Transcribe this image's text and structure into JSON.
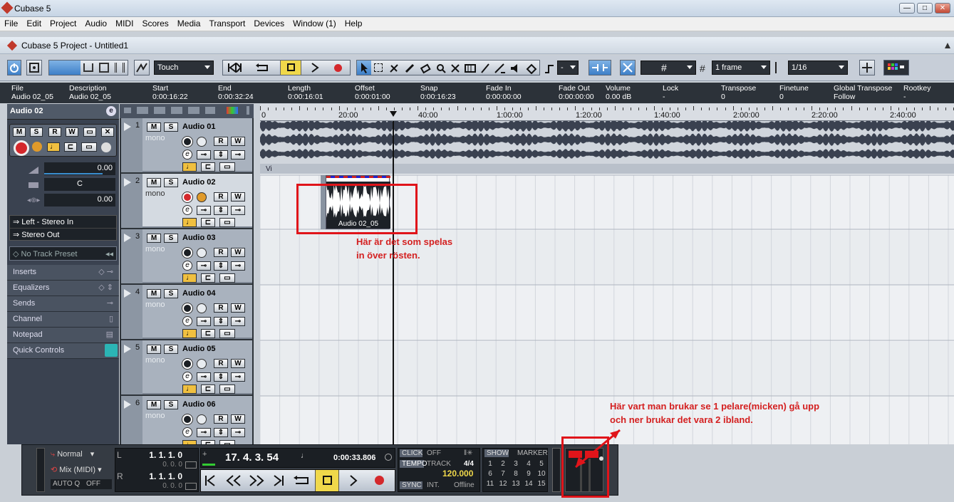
{
  "window": {
    "title": "Cubase 5",
    "buttons": [
      "—",
      "□",
      "✕"
    ]
  },
  "menu": [
    "File",
    "Edit",
    "Project",
    "Audio",
    "MIDI",
    "Scores",
    "Media",
    "Transport",
    "Devices",
    "Window (1)",
    "Help"
  ],
  "project_title": "Cubase 5 Project - Untitled1",
  "toolbar": {
    "automation_mode": "Touch",
    "nudge": "-",
    "grid_type_value": "",
    "quantize_label": "1 frame",
    "quantize_value": "1/16"
  },
  "infoline": {
    "columns": [
      {
        "label": "File",
        "value": "Audio 02_05"
      },
      {
        "label": "Description",
        "value": "Audio 02_05"
      },
      {
        "label": "Start",
        "value": "0:00:16:22"
      },
      {
        "label": "End",
        "value": "0:00:32:24"
      },
      {
        "label": "Length",
        "value": "0:00:16:01"
      },
      {
        "label": "Offset",
        "value": "0:00:01:00"
      },
      {
        "label": "Snap",
        "value": "0:00:16:23"
      },
      {
        "label": "Fade In",
        "value": "0:00:00:00"
      },
      {
        "label": "Fade Out",
        "value": "0:00:00:00"
      },
      {
        "label": "Volume",
        "value": "0.00 dB"
      },
      {
        "label": "Lock",
        "value": "-"
      },
      {
        "label": "Transpose",
        "value": "0"
      },
      {
        "label": "Finetune",
        "value": "0"
      },
      {
        "label": "Global Transpose",
        "value": "Follow"
      },
      {
        "label": "Rootkey",
        "value": "-"
      }
    ]
  },
  "inspector": {
    "track_name": "Audio 02",
    "volume": "0.00",
    "pan": "C",
    "delay": "0.00",
    "input_routing": "Left - Stereo In",
    "output_routing": "Stereo Out",
    "preset": "No Track Preset",
    "sections": [
      "Inserts",
      "Equalizers",
      "Sends",
      "Channel",
      "Notepad",
      "Quick Controls"
    ]
  },
  "tracks": [
    {
      "num": "1",
      "name": "Audio 01",
      "type": "mono",
      "m": "M",
      "s": "S",
      "r": "R",
      "w": "W",
      "recording": false
    },
    {
      "num": "2",
      "name": "Audio 02",
      "type": "mono",
      "m": "M",
      "s": "S",
      "r": "R",
      "w": "W",
      "recording": true
    },
    {
      "num": "3",
      "name": "Audio 03",
      "type": "mono",
      "m": "M",
      "s": "S",
      "r": "R",
      "w": "W",
      "recording": false
    },
    {
      "num": "4",
      "name": "Audio 04",
      "type": "mono",
      "m": "M",
      "s": "S",
      "r": "R",
      "w": "W",
      "recording": false
    },
    {
      "num": "5",
      "name": "Audio 05",
      "type": "mono",
      "m": "M",
      "s": "S",
      "r": "R",
      "w": "W",
      "recording": false
    },
    {
      "num": "6",
      "name": "Audio 06",
      "type": "mono",
      "m": "M",
      "s": "S",
      "r": "R",
      "w": "W",
      "recording": false
    }
  ],
  "ruler": [
    "0",
    "20:00",
    "40:00",
    "1:00:00",
    "1:20:00",
    "1:40:00",
    "2:00:00",
    "2:20:00",
    "2:40:00"
  ],
  "arrange": {
    "track1_part_label": "Vi",
    "track2_event_label": "Audio 02_05"
  },
  "annotations": {
    "first": [
      "Här är det som spelas",
      "in över rösten."
    ],
    "second": [
      "Här vart man brukar se 1 pelare(micken) gå upp",
      "och ner brukar det vara 2 ibland."
    ]
  },
  "transport": {
    "mode": "Normal",
    "mix": "Mix (MIDI)",
    "autoq_label": "AUTO Q",
    "autoq_value": "OFF",
    "left_locator": "1. 1. 1.   0",
    "left_sub": "0.  0.  0",
    "right_locator": "1. 1. 1.   0",
    "right_sub": "0.  0.  0",
    "position_bars": "17. 4. 3. 54",
    "position_time": "0:00:33.806",
    "click_label": "CLICK",
    "click_value": "OFF",
    "tempo_label": "TEMPO",
    "tempo_track": "TRACK",
    "signature": "4/4",
    "tempo": "120.000",
    "sync_label": "SYNC",
    "sync_int": "INT.",
    "sync_value": "Offline",
    "show_label": "SHOW",
    "marker_label": "MARKER",
    "markers": [
      "1",
      "2",
      "3",
      "4",
      "5",
      "6",
      "7",
      "8",
      "9",
      "10",
      "11",
      "12",
      "13",
      "14",
      "15"
    ]
  },
  "colors": {
    "annotation_red": "#e0141a",
    "record_red": "#d4282c",
    "cycle_yellow": "#f0d84a",
    "waveform": "#3a4150"
  }
}
